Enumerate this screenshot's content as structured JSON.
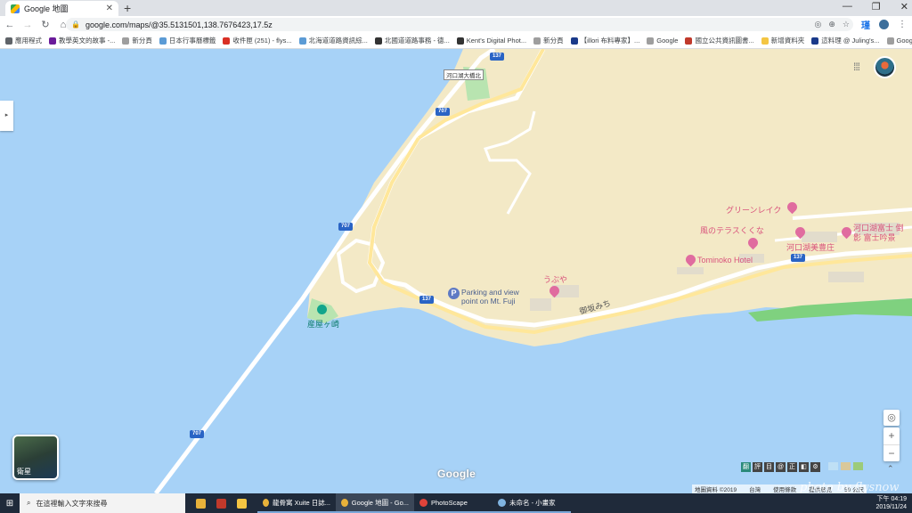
{
  "browser": {
    "tab_title": "Google 地圖",
    "url": "google.com/maps/@35.5131501,138.7676423,17.5z",
    "window_controls": [
      "—",
      "❐",
      "✕"
    ],
    "ext_label": "瑾",
    "bookmarks": [
      {
        "label": "應用程式",
        "color": "#5f6368"
      },
      {
        "label": "教學英文的故事 -...",
        "color": "#6a1b9a"
      },
      {
        "label": "新分頁",
        "color": "#9e9e9e"
      },
      {
        "label": "日本行事曆標籤",
        "color": "#5b9bd5"
      },
      {
        "label": "收件匣 (251) - flys...",
        "color": "#d93025"
      },
      {
        "label": "北海道道路資訊綜...",
        "color": "#5b9bd5"
      },
      {
        "label": "北國道道路事務 - 德...",
        "color": "#333333"
      },
      {
        "label": "Kent's Digital Phot...",
        "color": "#333333"
      },
      {
        "label": "新分頁",
        "color": "#9e9e9e"
      },
      {
        "label": "【illori 布料專家】...",
        "color": "#1a3a8a"
      },
      {
        "label": "Google",
        "color": "#9e9e9e"
      },
      {
        "label": "國立公共資訊圖書...",
        "color": "#c0392b"
      },
      {
        "label": "新增資料夾",
        "color": "#f4c542"
      },
      {
        "label": "這料理 @ Juling's...",
        "color": "#1a3a8a"
      },
      {
        "label": "Google",
        "color": "#9e9e9e"
      }
    ]
  },
  "map": {
    "water_color": "#a7d2f7",
    "land_color": "#f3e9c6",
    "road_color": "#fff1b8",
    "pois": {
      "bridge": "河口湖大橋北",
      "parking": "Parking and view point on Mt. Fuji",
      "cape": "産屋ヶ崎",
      "green_lake": "グリーンレイク",
      "kaze_terrace": "風のテラスくくな",
      "ubuya": "うぶや",
      "tominoko": "Tominoko Hotel",
      "kawaguchiko_fuji": "河口湖富士 倒影 富士吟景",
      "kawaguchiko_bisousou": "河口湖美豊庄",
      "road_name": "御坂みち"
    },
    "route_shields": [
      "137",
      "707",
      "707",
      "137",
      "137",
      "707"
    ],
    "satellite_label": "衛星",
    "google_logo": "Google",
    "footer": [
      "地圖資料 ©2019",
      "台灣",
      "使用條款",
      "提供意見",
      "50 公尺"
    ],
    "zoom_in": "+",
    "zoom_out": "−",
    "ext_tools": [
      "翻",
      "評",
      "目",
      "@",
      "正",
      "◧",
      "⚙"
    ]
  },
  "taskbar": {
    "search_placeholder": "在這裡輸入文字來搜尋",
    "apps": [
      {
        "label": "龍骨寓 Xuite 日誌...",
        "color": "#e8b23a",
        "active": false
      },
      {
        "label": "Google 地圖 - Go...",
        "color": "#e8b23a",
        "active": true
      },
      {
        "label": "PhotoScape",
        "color": "#e0433a",
        "active": false
      },
      {
        "label": "未命名 - 小畫家",
        "color": "#7fb3e0",
        "active": false
      }
    ],
    "time": "下午 04:19",
    "date": "2019/11/24",
    "watermark": "photo by flysnow"
  }
}
